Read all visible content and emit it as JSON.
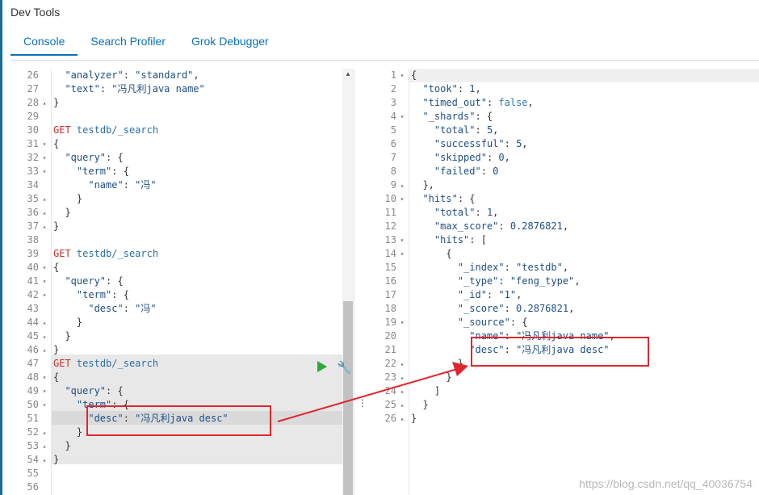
{
  "app": {
    "title": "Dev Tools"
  },
  "tabs": [
    {
      "label": "Console",
      "active": true
    },
    {
      "label": "Search Profiler",
      "active": false
    },
    {
      "label": "Grok Debugger",
      "active": false
    }
  ],
  "request_editor": {
    "lines": [
      {
        "n": "26",
        "fold": "",
        "html": "  <span class='k-key'>\"analyzer\"</span><span class='k-punct'>: </span><span class='k-str'>\"standard\"</span><span class='k-punct'>,</span>"
      },
      {
        "n": "27",
        "fold": "",
        "html": "  <span class='k-key'>\"text\"</span><span class='k-punct'>: </span><span class='k-str'>\"冯凡利java name\"</span>"
      },
      {
        "n": "28",
        "fold": "▴",
        "html": "<span class='k-punct'>}</span>"
      },
      {
        "n": "29",
        "fold": "",
        "html": ""
      },
      {
        "n": "30",
        "fold": "",
        "html": "<span class='k-method'>GET</span> <span class='k-url'>testdb/_search</span>"
      },
      {
        "n": "31",
        "fold": "▾",
        "html": "<span class='k-punct'>{</span>"
      },
      {
        "n": "32",
        "fold": "▾",
        "html": "  <span class='k-key'>\"query\"</span><span class='k-punct'>: {</span>"
      },
      {
        "n": "33",
        "fold": "▾",
        "html": "    <span class='k-key'>\"term\"</span><span class='k-punct'>: {</span>"
      },
      {
        "n": "34",
        "fold": "",
        "html": "      <span class='k-key'>\"name\"</span><span class='k-punct'>: </span><span class='k-str'>\"冯\"</span>"
      },
      {
        "n": "35",
        "fold": "▴",
        "html": "    <span class='k-punct'>}</span>"
      },
      {
        "n": "36",
        "fold": "▴",
        "html": "  <span class='k-punct'>}</span>"
      },
      {
        "n": "37",
        "fold": "▴",
        "html": "<span class='k-punct'>}</span>"
      },
      {
        "n": "38",
        "fold": "",
        "html": ""
      },
      {
        "n": "39",
        "fold": "",
        "html": "<span class='k-method'>GET</span> <span class='k-url'>testdb/_search</span>"
      },
      {
        "n": "40",
        "fold": "▾",
        "html": "<span class='k-punct'>{</span>"
      },
      {
        "n": "41",
        "fold": "▾",
        "html": "  <span class='k-key'>\"query\"</span><span class='k-punct'>: {</span>"
      },
      {
        "n": "42",
        "fold": "▾",
        "html": "    <span class='k-key'>\"term\"</span><span class='k-punct'>: {</span>"
      },
      {
        "n": "43",
        "fold": "",
        "html": "      <span class='k-key'>\"desc\"</span><span class='k-punct'>: </span><span class='k-str'>\"冯\"</span>"
      },
      {
        "n": "44",
        "fold": "▴",
        "html": "    <span class='k-punct'>}</span>"
      },
      {
        "n": "45",
        "fold": "▴",
        "html": "  <span class='k-punct'>}</span>"
      },
      {
        "n": "46",
        "fold": "▴",
        "html": "<span class='k-punct'>}</span>"
      },
      {
        "n": "47",
        "fold": "",
        "html": "<span class='k-method'>GET</span> <span class='k-url'>testdb/_search</span>"
      },
      {
        "n": "48",
        "fold": "▾",
        "html": "<span class='k-punct'>{</span>"
      },
      {
        "n": "49",
        "fold": "▾",
        "html": "  <span class='k-key'>\"query\"</span><span class='k-punct'>: {</span>"
      },
      {
        "n": "50",
        "fold": "▾",
        "html": "    <span class='k-key'>\"term\"</span><span class='k-punct'>: {</span>"
      },
      {
        "n": "51",
        "fold": "",
        "html": "      <span class='k-key'>\"desc\"</span><span class='k-punct'>: </span><span class='k-str'>\"冯凡利java desc\"</span>"
      },
      {
        "n": "52",
        "fold": "▴",
        "html": "    <span class='k-punct'>}</span>"
      },
      {
        "n": "53",
        "fold": "▴",
        "html": "  <span class='k-punct'>}</span>"
      },
      {
        "n": "54",
        "fold": "▴",
        "html": "<span class='k-punct'>}</span>"
      },
      {
        "n": "55",
        "fold": "",
        "html": ""
      },
      {
        "n": "56",
        "fold": "",
        "html": ""
      }
    ]
  },
  "response_viewer": {
    "lines": [
      {
        "n": "1",
        "fold": "▾",
        "html": "<span class='k-punct'>{</span>"
      },
      {
        "n": "2",
        "fold": "",
        "html": "  <span class='k-key'>\"took\"</span><span class='k-punct'>: </span><span class='k-num'>1</span><span class='k-punct'>,</span>"
      },
      {
        "n": "3",
        "fold": "",
        "html": "  <span class='k-key'>\"timed_out\"</span><span class='k-punct'>: </span><span class='k-bool'>false</span><span class='k-punct'>,</span>"
      },
      {
        "n": "4",
        "fold": "▾",
        "html": "  <span class='k-key'>\"_shards\"</span><span class='k-punct'>: {</span>"
      },
      {
        "n": "5",
        "fold": "",
        "html": "    <span class='k-key'>\"total\"</span><span class='k-punct'>: </span><span class='k-num'>5</span><span class='k-punct'>,</span>"
      },
      {
        "n": "6",
        "fold": "",
        "html": "    <span class='k-key'>\"successful\"</span><span class='k-punct'>: </span><span class='k-num'>5</span><span class='k-punct'>,</span>"
      },
      {
        "n": "7",
        "fold": "",
        "html": "    <span class='k-key'>\"skipped\"</span><span class='k-punct'>: </span><span class='k-num'>0</span><span class='k-punct'>,</span>"
      },
      {
        "n": "8",
        "fold": "",
        "html": "    <span class='k-key'>\"failed\"</span><span class='k-punct'>: </span><span class='k-num'>0</span>"
      },
      {
        "n": "9",
        "fold": "▴",
        "html": "  <span class='k-punct'>},</span>"
      },
      {
        "n": "10",
        "fold": "▾",
        "html": "  <span class='k-key'>\"hits\"</span><span class='k-punct'>: {</span>"
      },
      {
        "n": "11",
        "fold": "",
        "html": "    <span class='k-key'>\"total\"</span><span class='k-punct'>: </span><span class='k-num'>1</span><span class='k-punct'>,</span>"
      },
      {
        "n": "12",
        "fold": "",
        "html": "    <span class='k-key'>\"max_score\"</span><span class='k-punct'>: </span><span class='k-num'>0.2876821</span><span class='k-punct'>,</span>"
      },
      {
        "n": "13",
        "fold": "▾",
        "html": "    <span class='k-key'>\"hits\"</span><span class='k-punct'>: [</span>"
      },
      {
        "n": "14",
        "fold": "▾",
        "html": "      <span class='k-punct'>{</span>"
      },
      {
        "n": "15",
        "fold": "",
        "html": "        <span class='k-key'>\"_index\"</span><span class='k-punct'>: </span><span class='k-str'>\"testdb\"</span><span class='k-punct'>,</span>"
      },
      {
        "n": "16",
        "fold": "",
        "html": "        <span class='k-key'>\"_type\"</span><span class='k-punct'>: </span><span class='k-str'>\"feng_type\"</span><span class='k-punct'>,</span>"
      },
      {
        "n": "17",
        "fold": "",
        "html": "        <span class='k-key'>\"_id\"</span><span class='k-punct'>: </span><span class='k-str'>\"1\"</span><span class='k-punct'>,</span>"
      },
      {
        "n": "18",
        "fold": "",
        "html": "        <span class='k-key'>\"_score\"</span><span class='k-punct'>: </span><span class='k-num'>0.2876821</span><span class='k-punct'>,</span>"
      },
      {
        "n": "19",
        "fold": "▾",
        "html": "        <span class='k-key'>\"_source\"</span><span class='k-punct'>: {</span>"
      },
      {
        "n": "20",
        "fold": "",
        "html": "          <span class='k-key'>\"name\"</span><span class='k-punct'>: </span><span class='k-str'>\"冯凡利java name\"</span><span class='k-punct'>,</span>"
      },
      {
        "n": "21",
        "fold": "",
        "html": "          <span class='k-key'>\"desc\"</span><span class='k-punct'>: </span><span class='k-str'>\"冯凡利java desc\"</span>"
      },
      {
        "n": "22",
        "fold": "▴",
        "html": "        <span class='k-punct'>}</span>"
      },
      {
        "n": "23",
        "fold": "▴",
        "html": "      <span class='k-punct'>}</span>"
      },
      {
        "n": "24",
        "fold": "▴",
        "html": "    <span class='k-punct'>]</span>"
      },
      {
        "n": "25",
        "fold": "▴",
        "html": "  <span class='k-punct'>}</span>"
      },
      {
        "n": "26",
        "fold": "▴",
        "html": "<span class='k-punct'>}</span>"
      }
    ]
  },
  "watermark": "https://blog.csdn.net/qq_40036754",
  "icons": {
    "send": "play-icon",
    "settings": "wrench-icon",
    "divider": "drag-handle-icon"
  },
  "colors": {
    "accent": "#0a71b8",
    "annotation": "#e0262e",
    "method": "#c9302c",
    "send": "#2fa83a"
  }
}
